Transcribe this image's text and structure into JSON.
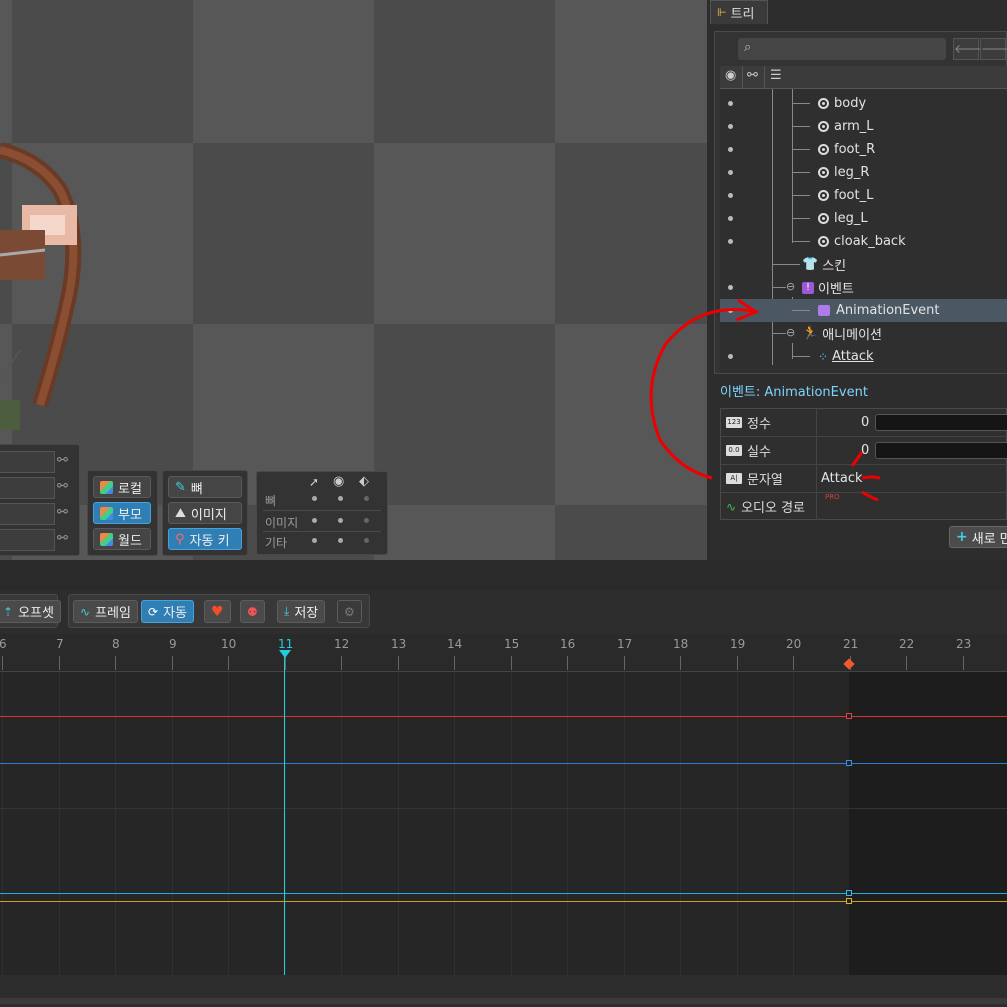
{
  "tree_panel": {
    "tab_label": "트리",
    "search_placeholder": "",
    "items": [
      {
        "label": "body",
        "kind": "bone"
      },
      {
        "label": "arm_L",
        "kind": "bone"
      },
      {
        "label": "foot_R",
        "kind": "bone"
      },
      {
        "label": "leg_R",
        "kind": "bone"
      },
      {
        "label": "foot_L",
        "kind": "bone"
      },
      {
        "label": "leg_L",
        "kind": "bone"
      },
      {
        "label": "cloak_back",
        "kind": "bone"
      },
      {
        "label": "스킨",
        "kind": "skins"
      },
      {
        "label": "이벤트",
        "kind": "events"
      },
      {
        "label": "AnimationEvent",
        "kind": "event",
        "selected": true
      },
      {
        "label": "애니메이션",
        "kind": "animations"
      },
      {
        "label": "Attack",
        "kind": "animation"
      }
    ]
  },
  "event_properties": {
    "title": "이벤트: AnimationEvent",
    "rows": [
      {
        "type_icon": "123",
        "label": "정수",
        "value": "0"
      },
      {
        "type_icon": "0.0",
        "label": "실수",
        "value": "0"
      },
      {
        "type_icon": "A|",
        "label": "문자열",
        "value": "Attack"
      },
      {
        "type_icon": "audio",
        "label": "오디오 경로",
        "value": ""
      }
    ],
    "pro_badge": "PRO",
    "new_button": "새로 만들기"
  },
  "viewport_tools": {
    "axes": [
      "로컬",
      "부모",
      "월드"
    ],
    "active_axis": "부모",
    "display": [
      "뼈",
      "이미지",
      "자동 키"
    ],
    "options": {
      "header_icons": [
        "cursor-icon",
        "eye-icon",
        "tag-icon"
      ],
      "rows": [
        "뼈",
        "이미지",
        "기타"
      ]
    }
  },
  "dopesheet_toolbar": {
    "offset": "오프셋",
    "frame": "프레임",
    "auto": "자동",
    "save": "저장"
  },
  "timeline": {
    "frames": [
      "6",
      "7",
      "8",
      "9",
      "10",
      "11",
      "12",
      "13",
      "14",
      "15",
      "16",
      "17",
      "18",
      "19",
      "20",
      "21",
      "22",
      "23"
    ],
    "current_frame": "11",
    "end_frame": "21",
    "colors": {
      "red": "#d63333",
      "blue": "#2a7fd4",
      "cyan": "#23a8e0",
      "yellow": "#c7a21a",
      "playhead": "#1ecfe0"
    }
  }
}
